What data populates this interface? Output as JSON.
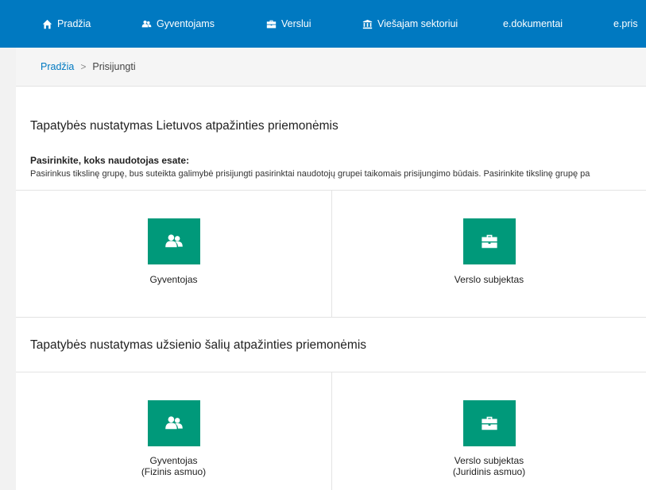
{
  "nav": {
    "items": [
      {
        "label": "Pradžia",
        "icon": "home-icon"
      },
      {
        "label": "Gyventojams",
        "icon": "people-icon"
      },
      {
        "label": "Verslui",
        "icon": "briefcase-icon"
      },
      {
        "label": "Viešajam sektoriui",
        "icon": "institution-icon"
      },
      {
        "label": "e.dokumentai",
        "icon": ""
      },
      {
        "label": "e.pris",
        "icon": ""
      }
    ],
    "color": "#0079c1"
  },
  "breadcrumb": {
    "home": "Pradžia",
    "separator": ">",
    "current": "Prisijungti"
  },
  "lt_section": {
    "title": "Tapatybės nustatymas Lietuvos atpažinties priemonėmis",
    "choose_label": "Pasirinkite, koks naudotojas esate:",
    "description": "Pasirinkus tikslinę grupę, bus suteikta galimybė prisijungti pasirinktai naudotojų grupei taikomais prisijungimo būdais. Pasirinkite tikslinę grupę pa",
    "cards": [
      {
        "label": "Gyventojas",
        "icon": "people-icon"
      },
      {
        "label": "Verslo subjektas",
        "icon": "briefcase-icon"
      }
    ]
  },
  "foreign_section": {
    "title": "Tapatybės nustatymas užsienio šalių atpažinties priemonėmis",
    "cards": [
      {
        "label": "Gyventojas",
        "sublabel": "(Fizinis asmuo)",
        "icon": "people-icon"
      },
      {
        "label": "Verslo subjektas",
        "sublabel": "(Juridinis asmuo)",
        "icon": "briefcase-icon"
      }
    ]
  },
  "colors": {
    "accent": "#0079c1",
    "card_icon_bg": "#00997a"
  }
}
